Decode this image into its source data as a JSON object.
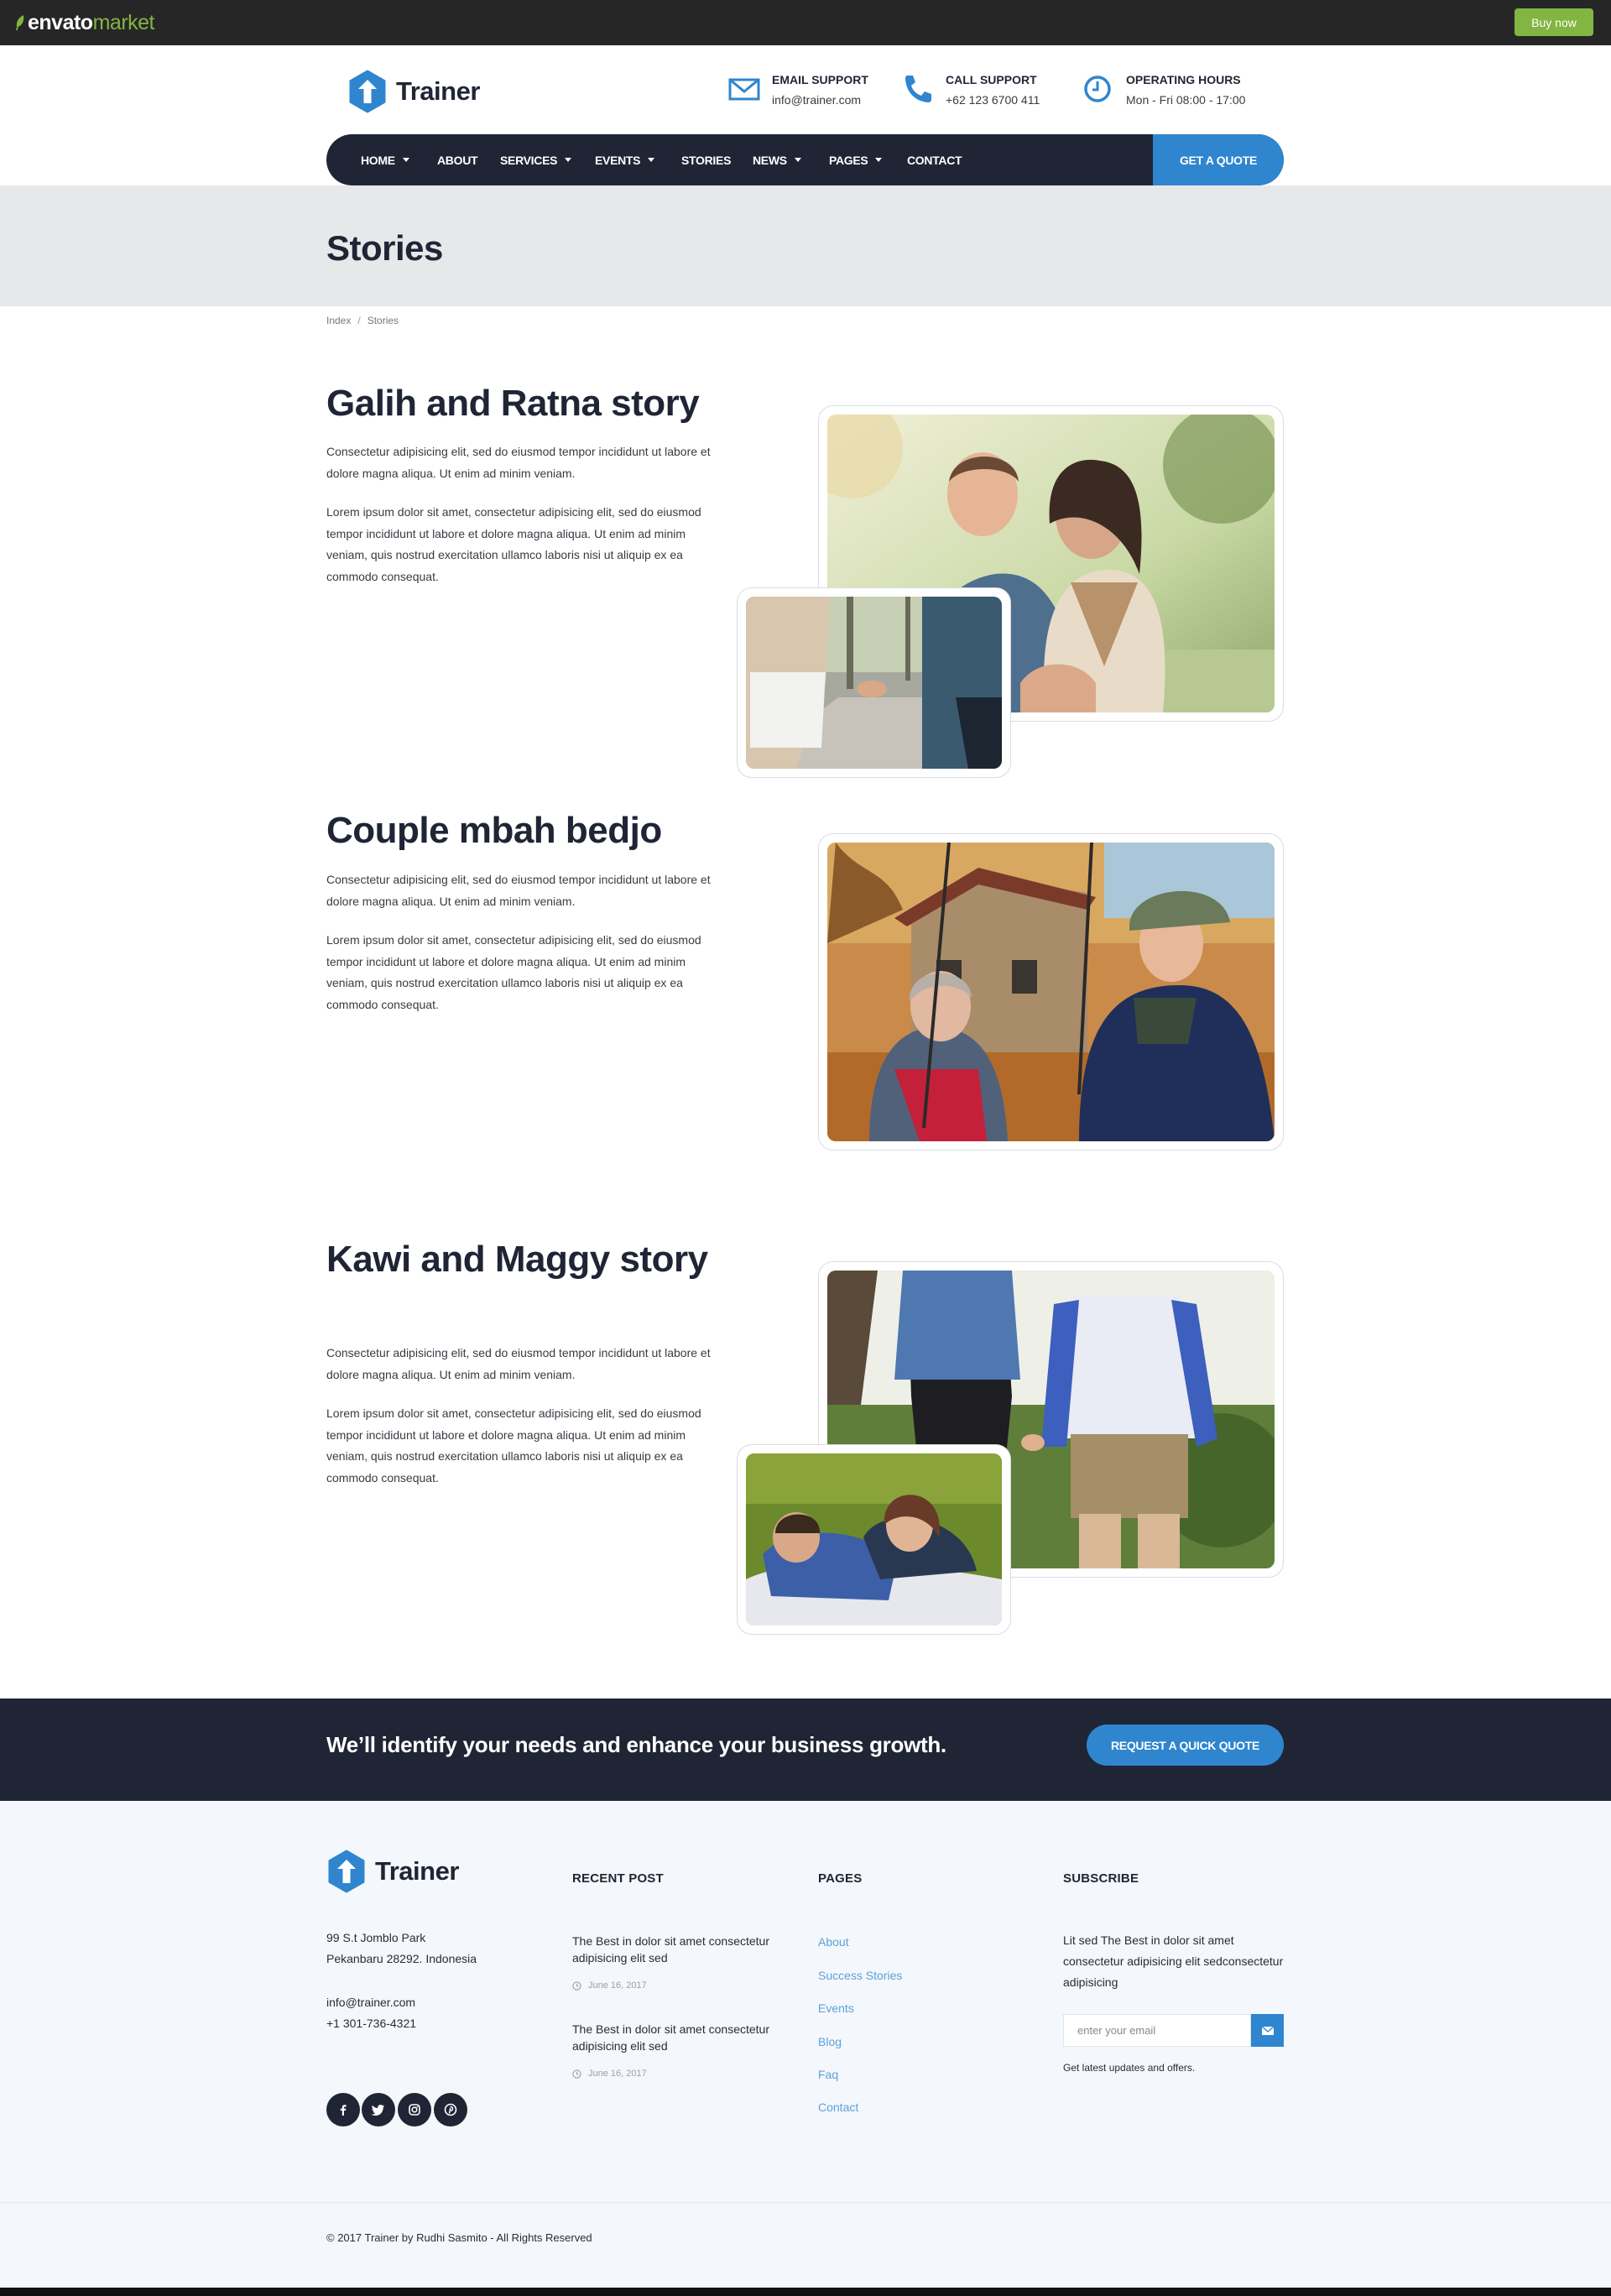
{
  "envato": {
    "logo_primary": "envato",
    "logo_secondary": "market",
    "buy_now": "Buy now"
  },
  "header": {
    "brand": "Trainer",
    "email": {
      "label": "EMAIL SUPPORT",
      "value": "info@trainer.com"
    },
    "call": {
      "label": "CALL SUPPORT",
      "value": "+62 123 6700 411"
    },
    "hours": {
      "label": "OPERATING HOURS",
      "value": "Mon - Fri 08:00 - 17:00"
    }
  },
  "nav": {
    "items": [
      {
        "label": "HOME",
        "dropdown": true
      },
      {
        "label": "ABOUT",
        "dropdown": false
      },
      {
        "label": "SERVICES",
        "dropdown": true
      },
      {
        "label": "EVENTS",
        "dropdown": true
      },
      {
        "label": "STORIES",
        "dropdown": false
      },
      {
        "label": "NEWS",
        "dropdown": true
      },
      {
        "label": "PAGES",
        "dropdown": true
      },
      {
        "label": "CONTACT",
        "dropdown": false
      }
    ],
    "quote": "GET A QUOTE"
  },
  "page": {
    "title": "Stories",
    "breadcrumb": [
      "Index",
      "Stories"
    ]
  },
  "stories": [
    {
      "title": "Galih and Ratna story",
      "p1": "Consectetur adipisicing elit, sed do eiusmod tempor incididunt ut labore et dolore magna aliqua. Ut enim ad minim veniam.",
      "p2": "Lorem ipsum dolor sit amet, consectetur adipisicing elit, sed do eiusmod tempor incididunt ut labore et dolore magna aliqua. Ut enim ad minim veniam, quis nostrud exercitation ullamco laboris nisi ut aliquip ex ea commodo consequat."
    },
    {
      "title": "Couple mbah bedjo",
      "p1": "Consectetur adipisicing elit, sed do eiusmod tempor incididunt ut labore et dolore magna aliqua. Ut enim ad minim veniam.",
      "p2": "Lorem ipsum dolor sit amet, consectetur adipisicing elit, sed do eiusmod tempor incididunt ut labore et dolore magna aliqua. Ut enim ad minim veniam, quis nostrud exercitation ullamco laboris nisi ut aliquip ex ea commodo consequat."
    },
    {
      "title": "Kawi and Maggy story",
      "p1": "Consectetur adipisicing elit, sed do eiusmod tempor incididunt ut labore et dolore magna aliqua. Ut enim ad minim veniam.",
      "p2": "Lorem ipsum dolor sit amet, consectetur adipisicing elit, sed do eiusmod tempor incididunt ut labore et dolore magna aliqua. Ut enim ad minim veniam, quis nostrud exercitation ullamco laboris nisi ut aliquip ex ea commodo consequat."
    }
  ],
  "cta": {
    "text": "We’ll identify your needs and enhance your business growth.",
    "button": "REQUEST A QUICK QUOTE"
  },
  "footer": {
    "brand": "Trainer",
    "address": [
      "99 S.t Jomblo Park",
      "Pekanbaru 28292. Indonesia"
    ],
    "contact": [
      "info@trainer.com",
      "+1 301-736-4321"
    ],
    "recent_heading": "RECENT POST",
    "posts": [
      {
        "title": "The Best in dolor sit amet consectetur adipisicing elit sed",
        "date": "June 16, 2017"
      },
      {
        "title": "The Best in dolor sit amet consectetur adipisicing elit sed",
        "date": "June 16, 2017"
      }
    ],
    "pages_heading": "PAGES",
    "pages": [
      "About",
      "Success Stories",
      "Events",
      "Blog",
      "Faq",
      "Contact"
    ],
    "subscribe_heading": "SUBSCRIBE",
    "subscribe_text": "Lit sed The Best in dolor sit amet consectetur adipisicing elit sedconsectetur adipisicing",
    "email_placeholder": "enter your email",
    "subscribe_note": "Get latest updates and offers.",
    "social": [
      "facebook-icon",
      "twitter-icon",
      "instagram-icon",
      "pinterest-icon"
    ],
    "copyright": "© 2017 Trainer by Rudhi Sasmito - All Rights Reserved"
  },
  "colors": {
    "navy": "#1f2535",
    "accent": "#2f86cf",
    "envato_green": "#82b541",
    "band": "#e7e8ea",
    "footer_bg": "#f4f7fb"
  }
}
